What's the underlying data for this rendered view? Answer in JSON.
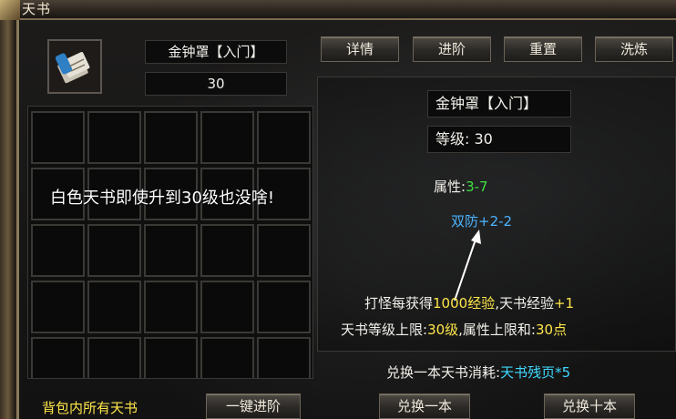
{
  "window": {
    "title": "天书"
  },
  "book": {
    "name": "金钟罩【入门】",
    "level": "30",
    "icon": "scroll-book-icon"
  },
  "tabs": {
    "details": "详情",
    "advance": "进阶",
    "reset": "重置",
    "refine": "洗炼"
  },
  "grid": {
    "overlay_text": "白色天书即使升到30级也没啥!"
  },
  "info": {
    "name": "金钟罩【入门】",
    "level_label": "等级:",
    "level_value": "30",
    "attr_label": "属性:",
    "attr_value": "3-7",
    "bonus_text": "双防+2-2",
    "exp_prefix": "打怪每获得",
    "exp_amount": "1000经验",
    "exp_mid": ",天书经验",
    "exp_gain": "+1",
    "limit_prefix": "天书等级上限:",
    "limit_level": "30级",
    "limit_mid": ",属性上限和:",
    "limit_points": "30点"
  },
  "exchange": {
    "cost_label": "兑换一本天书消耗:",
    "cost_value": "天书残页*5",
    "exchange_one": "兑换一本",
    "exchange_ten": "兑换十本"
  },
  "footer": {
    "bag_label": "背包内所有天书",
    "one_click": "一键进阶"
  },
  "colors": {
    "green": "#3fe13f",
    "blue": "#4bb3ff",
    "yellow": "#ffe64a",
    "cyan": "#3fd9ff"
  }
}
